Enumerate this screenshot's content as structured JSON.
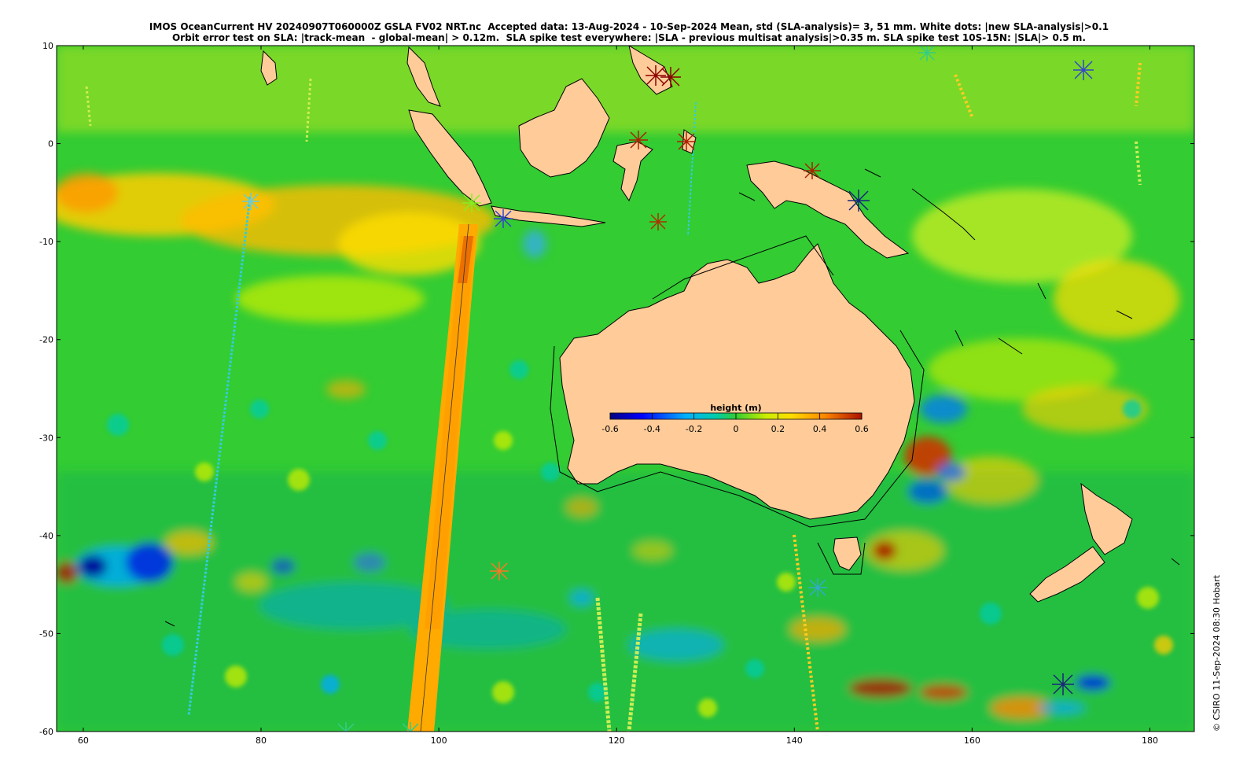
{
  "title": {
    "line1": "IMOS OceanCurrent HV 20240907T060000Z GSLA FV02 NRT.nc  Accepted data: 13-Aug-2024 - 10-Sep-2024 Mean, std (SLA-analysis)= 3, 51 mm. White dots: |new SLA-analysis|>0.1",
    "line2": "Orbit error test on SLA: |track-mean  - global-mean| > 0.12m.  SLA spike test everywhere: |SLA - previous multisat analysis|>0.35 m. SLA spike test 10S-15N: |SLA|> 0.5 m."
  },
  "map": {
    "lon_range": [
      57,
      185
    ],
    "lat_range": [
      -60,
      10
    ],
    "x_ticks": [
      "60",
      "80",
      "100",
      "120",
      "140",
      "160",
      "180"
    ],
    "y_ticks": [
      "10",
      "0",
      "-10",
      "-20",
      "-30",
      "-40",
      "-50",
      "-60"
    ],
    "colors": {
      "ocean_base": "#33cc33",
      "land": "#ffcc99",
      "coast": "#000000"
    }
  },
  "colorbar": {
    "title": "height (m)",
    "ticks": [
      "-0.6",
      "-0.4",
      "-0.2",
      "0",
      "0.2",
      "0.4",
      "0.6"
    ],
    "range": [
      -0.6,
      0.6
    ]
  },
  "credit": "© CSIRO 11-Sep-2024 08:30 Hobart"
}
